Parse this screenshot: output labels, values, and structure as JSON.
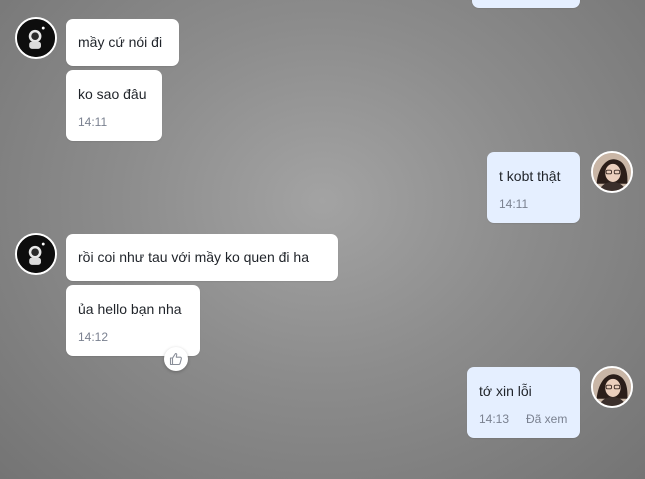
{
  "conversation": {
    "messages": [
      {
        "text": "mầy cứ nói đi"
      },
      {
        "text": "ko sao đâu",
        "time": "14:11"
      },
      {
        "text": "t kobt thật",
        "time": "14:11"
      },
      {
        "text": "rồi coi như tau với mầy ko quen đi ha"
      },
      {
        "text": "ủa hello bạn nha",
        "time": "14:12"
      },
      {
        "text": "tớ xin lỗi",
        "time": "14:13",
        "status": "Đã xem"
      }
    ]
  },
  "icons": {
    "other_avatar": "astronaut-avatar-icon",
    "self_avatar": "user-photo-avatar-icon",
    "reaction": "thumbs-up-icon"
  },
  "colors": {
    "background": "#8c8c8c",
    "bubble_incoming": "#ffffff",
    "bubble_outgoing": "#e5efff",
    "text": "#1f2329",
    "meta_text": "#7a8190"
  }
}
